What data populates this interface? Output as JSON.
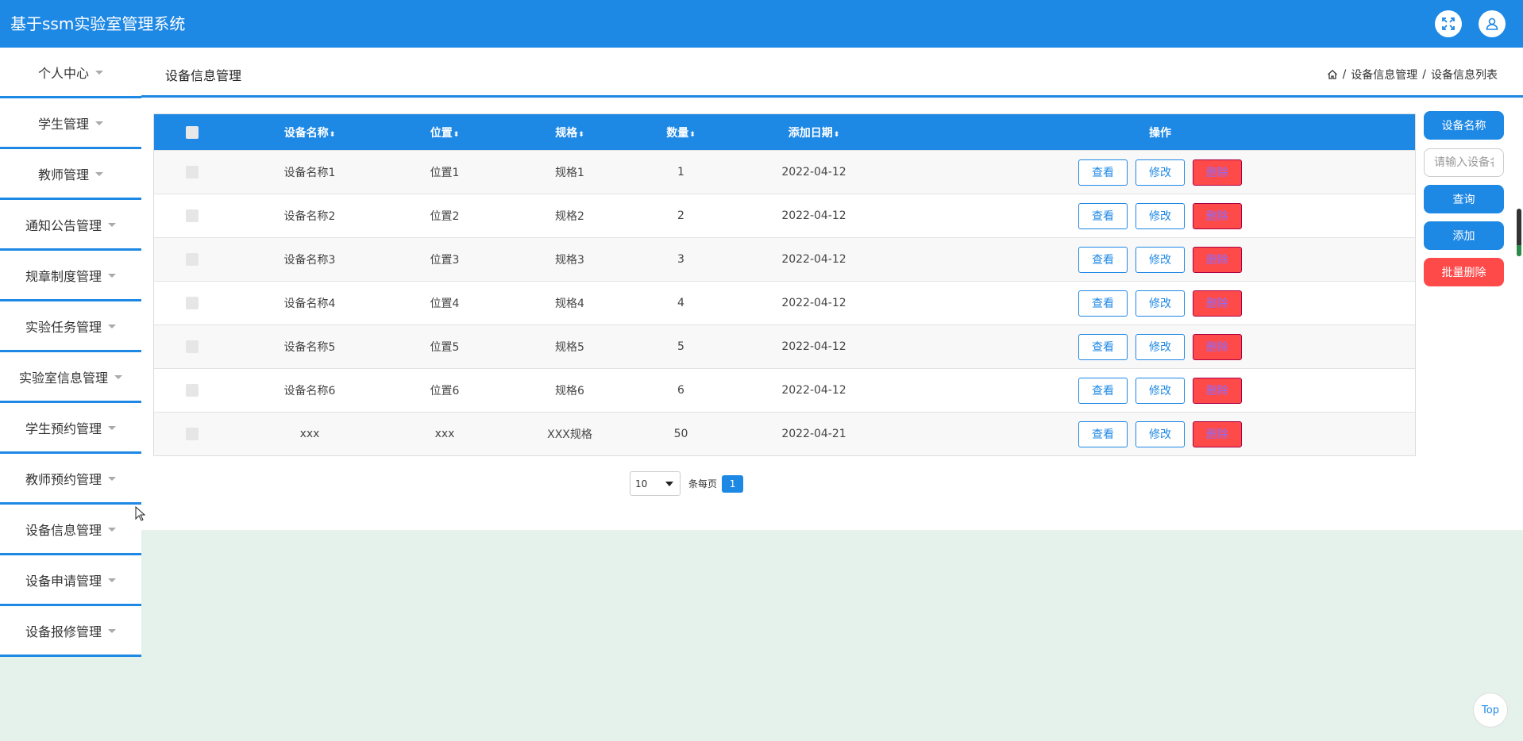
{
  "app": {
    "title": "基于ssm实验室管理系统"
  },
  "header": {
    "fullscreen_icon": "expand-arrows-icon",
    "user_icon": "user-icon"
  },
  "sidebar": {
    "items": [
      {
        "label": "个人中心"
      },
      {
        "label": "学生管理"
      },
      {
        "label": "教师管理"
      },
      {
        "label": "通知公告管理"
      },
      {
        "label": "规章制度管理"
      },
      {
        "label": "实验任务管理"
      },
      {
        "label": "实验室信息管理"
      },
      {
        "label": "学生预约管理"
      },
      {
        "label": "教师预约管理"
      },
      {
        "label": "设备信息管理"
      },
      {
        "label": "设备申请管理"
      },
      {
        "label": "设备报修管理"
      }
    ]
  },
  "main": {
    "page_title": "设备信息管理",
    "breadcrumb": {
      "home_icon": "home-icon",
      "level1": "设备信息管理",
      "sep": "/",
      "level2": "设备信息列表"
    }
  },
  "table": {
    "columns": {
      "name": "设备名称",
      "location": "位置",
      "spec": "规格",
      "quantity": "数量",
      "date": "添加日期",
      "ops": "操作"
    },
    "sort_glyph": "⬍",
    "actions": {
      "view": "查看",
      "edit": "修改",
      "delete": "删除"
    },
    "rows": [
      {
        "name": "设备名称1",
        "location": "位置1",
        "spec": "规格1",
        "quantity": "1",
        "date": "2022-04-12"
      },
      {
        "name": "设备名称2",
        "location": "位置2",
        "spec": "规格2",
        "quantity": "2",
        "date": "2022-04-12"
      },
      {
        "name": "设备名称3",
        "location": "位置3",
        "spec": "规格3",
        "quantity": "3",
        "date": "2022-04-12"
      },
      {
        "name": "设备名称4",
        "location": "位置4",
        "spec": "规格4",
        "quantity": "4",
        "date": "2022-04-12"
      },
      {
        "name": "设备名称5",
        "location": "位置5",
        "spec": "规格5",
        "quantity": "5",
        "date": "2022-04-12"
      },
      {
        "name": "设备名称6",
        "location": "位置6",
        "spec": "规格6",
        "quantity": "6",
        "date": "2022-04-12"
      },
      {
        "name": "xxx",
        "location": "xxx",
        "spec": "XXX规格",
        "quantity": "50",
        "date": "2022-04-21"
      }
    ]
  },
  "pagination": {
    "page_size": "10",
    "per_page_label": "条每页",
    "current_page": "1"
  },
  "search_panel": {
    "field_label": "设备名称",
    "input_placeholder": "请输入设备名称",
    "query_label": "查询",
    "add_label": "添加",
    "batch_delete_label": "批量删除"
  },
  "back_to_top": "Top",
  "colors": {
    "primary": "#1e88e5",
    "danger": "#ff4a4a",
    "background": "#e4f2eb"
  }
}
